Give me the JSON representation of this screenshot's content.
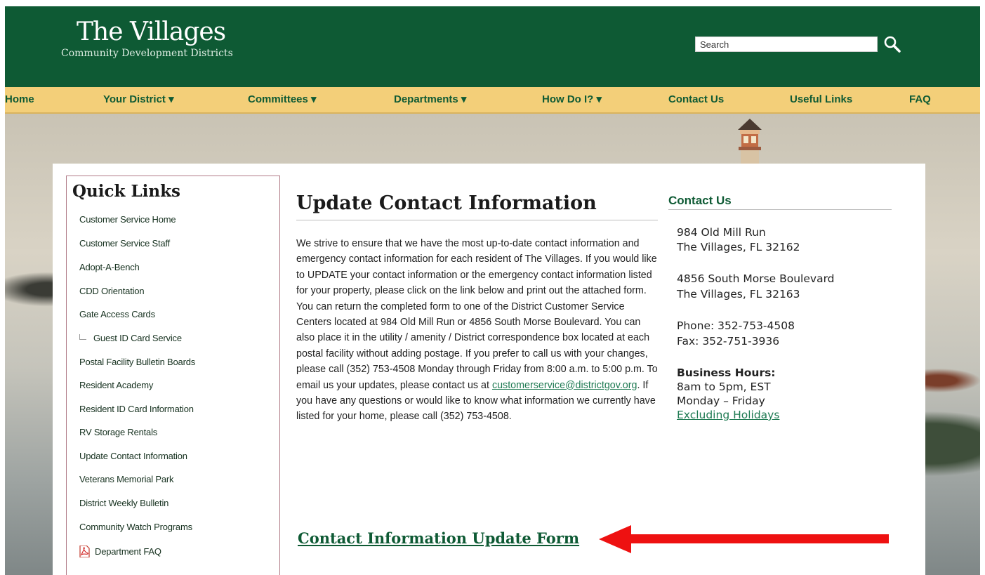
{
  "header": {
    "logo_main": "The Villages",
    "logo_sub": "Community Development Districts",
    "search_placeholder": "Search",
    "search_icon": "search-icon"
  },
  "nav": [
    {
      "label": "Home"
    },
    {
      "label": "Your District ▾"
    },
    {
      "label": "Committees ▾"
    },
    {
      "label": "Departments ▾"
    },
    {
      "label": "How Do I? ▾"
    },
    {
      "label": "Contact Us"
    },
    {
      "label": "Useful Links"
    },
    {
      "label": "FAQ"
    }
  ],
  "quick_links": {
    "title": "Quick Links",
    "items": [
      "Customer Service Home",
      "Customer Service Staff",
      "Adopt-A-Bench",
      "CDD Orientation",
      "Gate Access Cards",
      "Guest ID Card Service",
      "Postal Facility Bulletin Boards",
      "Resident Academy",
      "Resident ID Card Information",
      "RV Storage Rentals",
      "Update Contact Information",
      "Veterans Memorial Park",
      "District Weekly Bulletin",
      "Community Watch Programs",
      "Department FAQ"
    ]
  },
  "main": {
    "title": "Update Contact Information",
    "body_before_email": "We strive to ensure that we have the most up-to-date contact information and emergency contact information for each resident of The Villages.  If you would like to UPDATE your contact information or the emergency contact information listed for your property, please click on the link below and print out the attached form.  You can return the completed form to one of the District Customer Service Centers located at 984 Old Mill Run or 4856 South Morse Boulevard.  You can also place it in the utility / amenity / District correspondence box located at each postal facility without adding postage.  If you prefer to call us with your changes, please call (352) 753-4508 Monday through Friday from 8:00 a.m. to 5:00 p.m.  To email us your updates, please contact us at ",
    "email": "customerservice@districtgov.org",
    "body_after_email": ".  If you have any questions or would like to know what information we currently have listed for your home, please call (352) 753-4508.",
    "form_link": "Contact Information Update Form"
  },
  "contact": {
    "title": "Contact Us",
    "address1_line1": "984 Old Mill Run",
    "address1_line2": "The Villages, FL 32162",
    "address2_line1": "4856 South Morse Boulevard",
    "address2_line2": "The Villages, FL 32163",
    "phone": "Phone: 352-753-4508",
    "fax": "Fax: 352-751-3936",
    "hours_label": "Business Hours:",
    "hours": "8am to 5pm, EST",
    "days": "Monday – Friday",
    "holidays": "Excluding Holidays"
  },
  "colors": {
    "header_green": "#0e5a34",
    "nav_gold": "#f3cf79",
    "arrow_red": "#ee1111"
  }
}
